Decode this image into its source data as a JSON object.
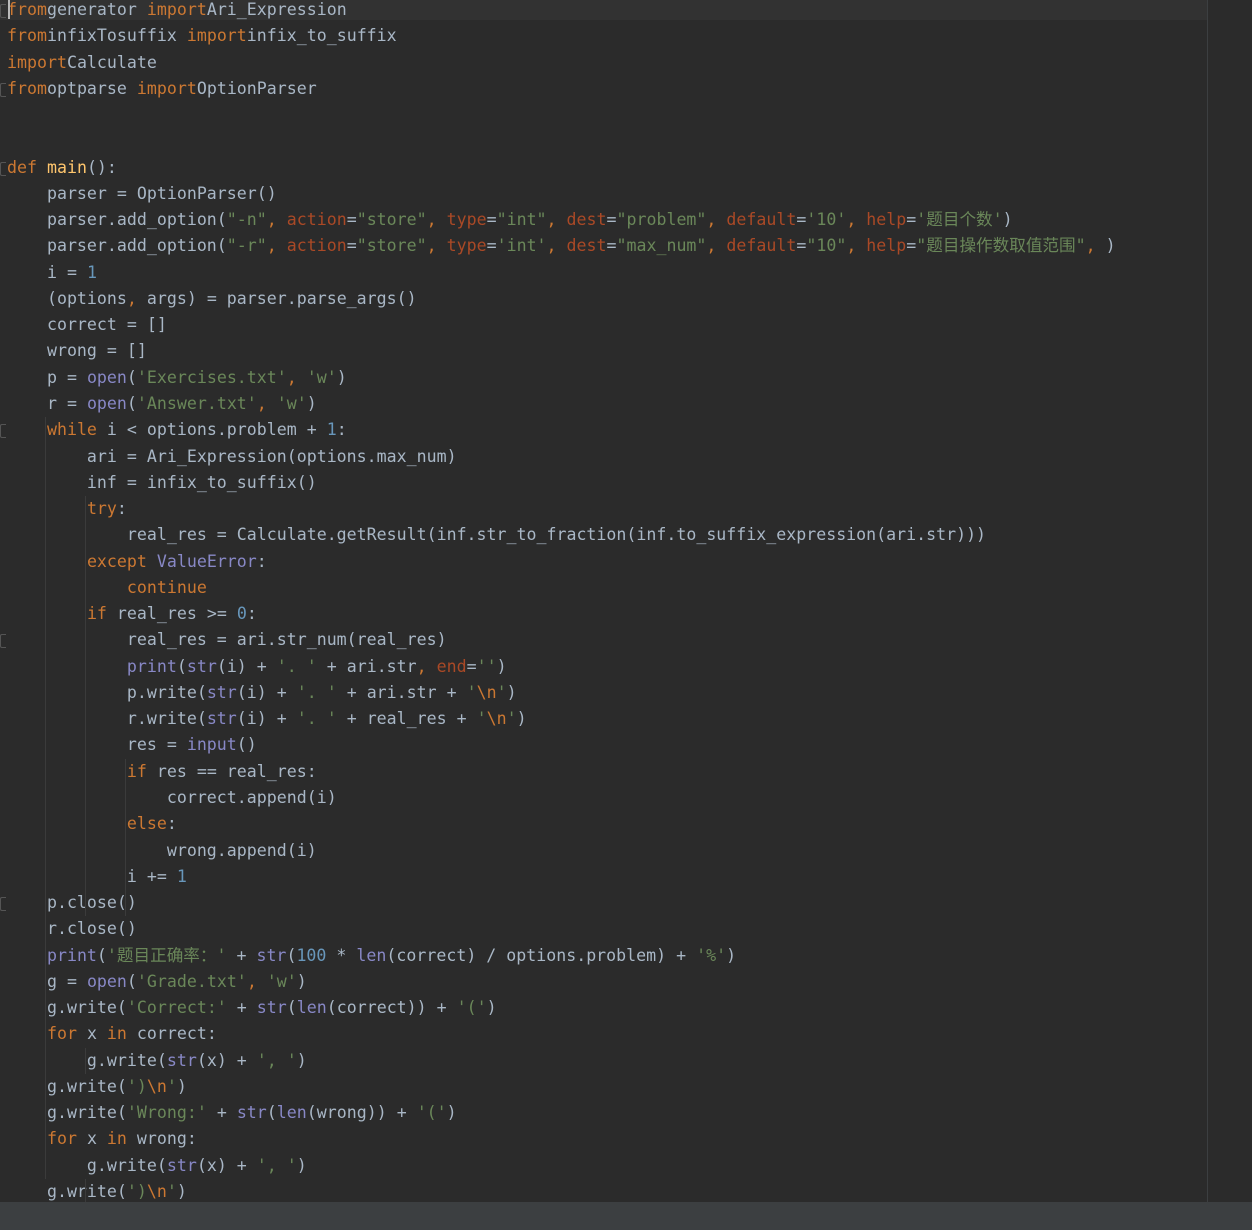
{
  "editor": {
    "language": "python",
    "lines": [
      [
        [
          "kw",
          "from"
        ],
        [
          "",
          "generator "
        ],
        [
          "kw",
          "import"
        ],
        [
          "",
          "Ari_Expression"
        ]
      ],
      [
        [
          "kw",
          "from"
        ],
        [
          "",
          "infixTosuffix "
        ],
        [
          "kw",
          "import"
        ],
        [
          "",
          "infix_to_suffix"
        ]
      ],
      [
        [
          "kw",
          "import"
        ],
        [
          "",
          "Calculate"
        ]
      ],
      [
        [
          "kw",
          "from"
        ],
        [
          "",
          "optparse "
        ],
        [
          "kw",
          "import"
        ],
        [
          "",
          "OptionParser"
        ]
      ],
      [],
      [],
      [
        [
          "kw",
          "def"
        ],
        [
          "",
          "main():"
        ]
      ],
      [
        [
          "",
          "    parser = OptionParser()"
        ]
      ],
      [
        [
          "",
          "    parser.add_option("
        ],
        [
          "str",
          "\"-n\""
        ],
        [
          "kw",
          ", "
        ],
        [
          "kwarg",
          "action"
        ],
        [
          "",
          "="
        ],
        [
          "str",
          "\"store\""
        ],
        [
          "kw",
          ", "
        ],
        [
          "kwarg",
          "type"
        ],
        [
          "",
          "="
        ],
        [
          "str",
          "\"int\""
        ],
        [
          "kw",
          ", "
        ],
        [
          "kwarg",
          "dest"
        ],
        [
          "",
          "="
        ],
        [
          "str",
          "\"problem\""
        ],
        [
          "kw",
          ", "
        ],
        [
          "kwarg",
          "default"
        ],
        [
          "",
          "="
        ],
        [
          "str",
          "'10'"
        ],
        [
          "kw",
          ", "
        ],
        [
          "kwarg",
          "help"
        ],
        [
          "",
          "="
        ],
        [
          "str",
          "'题目个数'"
        ],
        [
          "",
          ")"
        ]
      ],
      [
        [
          "",
          "    parser.add_option("
        ],
        [
          "str",
          "\"-r\""
        ],
        [
          "kw",
          ", "
        ],
        [
          "kwarg",
          "action"
        ],
        [
          "",
          "="
        ],
        [
          "str",
          "\"store\""
        ],
        [
          "kw",
          ", "
        ],
        [
          "kwarg",
          "type"
        ],
        [
          "",
          "="
        ],
        [
          "str",
          "'int'"
        ],
        [
          "kw",
          ", "
        ],
        [
          "kwarg",
          "dest"
        ],
        [
          "",
          "="
        ],
        [
          "str",
          "\"max_num\""
        ],
        [
          "kw",
          ", "
        ],
        [
          "kwarg",
          "default"
        ],
        [
          "",
          "="
        ],
        [
          "str",
          "\"10\""
        ],
        [
          "kw",
          ", "
        ],
        [
          "kwarg",
          "help"
        ],
        [
          "",
          "="
        ],
        [
          "str",
          "\"题目操作数取值范围\""
        ],
        [
          "kw",
          ", "
        ],
        [
          "",
          ")"
        ]
      ],
      [
        [
          "",
          "    i = "
        ],
        [
          "num",
          "1"
        ]
      ],
      [
        [
          "",
          "    (options"
        ],
        [
          "kw",
          ", "
        ],
        [
          "",
          "args) = parser.parse_args()"
        ]
      ],
      [
        [
          "",
          "    correct = []"
        ]
      ],
      [
        [
          "",
          "    wrong = []"
        ]
      ],
      [
        [
          "",
          "    p = "
        ],
        [
          "bi",
          "open"
        ],
        [
          "",
          "("
        ],
        [
          "str",
          "'Exercises.txt'"
        ],
        [
          "kw",
          ", "
        ],
        [
          "str",
          "'w'"
        ],
        [
          "",
          ")"
        ]
      ],
      [
        [
          "",
          "    r = "
        ],
        [
          "bi",
          "open"
        ],
        [
          "",
          "("
        ],
        [
          "str",
          "'Answer.txt'"
        ],
        [
          "kw",
          ", "
        ],
        [
          "str",
          "'w'"
        ],
        [
          "",
          ")"
        ]
      ],
      [
        [
          "",
          "    "
        ],
        [
          "kw",
          "while "
        ],
        [
          "",
          "i < options.problem + "
        ],
        [
          "num",
          "1"
        ],
        [
          "",
          ":"
        ]
      ],
      [
        [
          "",
          "        ari = Ari_Expression(options.max_num)"
        ]
      ],
      [
        [
          "",
          "        inf = infix_to_suffix()"
        ]
      ],
      [
        [
          "",
          "        "
        ],
        [
          "kw",
          "try"
        ],
        [
          "",
          ":"
        ]
      ],
      [
        [
          "",
          "            real_res = Calculate.getResult(inf.str_to_fraction(inf.to_suffix_expression(ari.str)))"
        ]
      ],
      [
        [
          "",
          "        "
        ],
        [
          "kw",
          "except "
        ],
        [
          "bi",
          "ValueError"
        ],
        [
          "",
          ":"
        ]
      ],
      [
        [
          "",
          "            "
        ],
        [
          "kw",
          "continue"
        ]
      ],
      [
        [
          "",
          "        "
        ],
        [
          "kw",
          "if "
        ],
        [
          "",
          "real_res >= "
        ],
        [
          "num",
          "0"
        ],
        [
          "",
          ":"
        ]
      ],
      [
        [
          "",
          "            real_res = ari.str_num(real_res)"
        ]
      ],
      [
        [
          "",
          "            "
        ],
        [
          "bi",
          "print"
        ],
        [
          "",
          "("
        ],
        [
          "bi",
          "str"
        ],
        [
          "",
          "(i) + "
        ],
        [
          "str",
          "'. '"
        ],
        [
          "",
          " + ari.str"
        ],
        [
          "kw",
          ", "
        ],
        [
          "kwarg",
          "end"
        ],
        [
          "",
          "="
        ],
        [
          "str",
          "''"
        ],
        [
          "",
          ")"
        ]
      ],
      [
        [
          "",
          "            p.write("
        ],
        [
          "bi",
          "str"
        ],
        [
          "",
          "(i) + "
        ],
        [
          "str",
          "'. '"
        ],
        [
          "",
          " + ari.str + "
        ],
        [
          "str",
          "'"
        ],
        [
          "esc",
          "\\n"
        ],
        [
          "str",
          "'"
        ],
        [
          "",
          ")"
        ]
      ],
      [
        [
          "",
          "            r.write("
        ],
        [
          "bi",
          "str"
        ],
        [
          "",
          "(i) + "
        ],
        [
          "str",
          "'. '"
        ],
        [
          "",
          " + real_res + "
        ],
        [
          "str",
          "'"
        ],
        [
          "esc",
          "\\n"
        ],
        [
          "str",
          "'"
        ],
        [
          "",
          ")"
        ]
      ],
      [
        [
          "",
          "            res = "
        ],
        [
          "bi",
          "input"
        ],
        [
          "",
          "()"
        ]
      ],
      [
        [
          "",
          "            "
        ],
        [
          "kw",
          "if "
        ],
        [
          "",
          "res == real_res:"
        ]
      ],
      [
        [
          "",
          "                correct.append(i)"
        ]
      ],
      [
        [
          "",
          "            "
        ],
        [
          "kw",
          "else"
        ],
        [
          "",
          ":"
        ]
      ],
      [
        [
          "",
          "                wrong.append(i)"
        ]
      ],
      [
        [
          "",
          "            i += "
        ],
        [
          "num",
          "1"
        ]
      ],
      [
        [
          "",
          "    p.close()"
        ]
      ],
      [
        [
          "",
          "    r.close()"
        ]
      ],
      [
        [
          "",
          "    "
        ],
        [
          "bi",
          "print"
        ],
        [
          "",
          "("
        ],
        [
          "str",
          "'题目正确率：'"
        ],
        [
          "",
          " + "
        ],
        [
          "bi",
          "str"
        ],
        [
          "",
          "("
        ],
        [
          "num",
          "100"
        ],
        [
          "",
          " * "
        ],
        [
          "bi",
          "len"
        ],
        [
          "",
          "(correct) / options.problem) + "
        ],
        [
          "str",
          "'%'"
        ],
        [
          "",
          ")"
        ]
      ],
      [
        [
          "",
          "    g = "
        ],
        [
          "bi",
          "open"
        ],
        [
          "",
          "("
        ],
        [
          "str",
          "'Grade.txt'"
        ],
        [
          "kw",
          ", "
        ],
        [
          "str",
          "'w'"
        ],
        [
          "",
          ")"
        ]
      ],
      [
        [
          "",
          "    g.write("
        ],
        [
          "str",
          "'Correct:'"
        ],
        [
          "",
          " + "
        ],
        [
          "bi",
          "str"
        ],
        [
          "",
          "("
        ],
        [
          "bi",
          "len"
        ],
        [
          "",
          "(correct)) + "
        ],
        [
          "str",
          "'('"
        ],
        [
          "",
          ")"
        ]
      ],
      [
        [
          "",
          "    "
        ],
        [
          "kw",
          "for "
        ],
        [
          "",
          "x "
        ],
        [
          "kw",
          "in "
        ],
        [
          "",
          "correct:"
        ]
      ],
      [
        [
          "",
          "        g.write("
        ],
        [
          "bi",
          "str"
        ],
        [
          "",
          "(x) + "
        ],
        [
          "str",
          "', '"
        ],
        [
          "",
          ")"
        ]
      ],
      [
        [
          "",
          "    g.write("
        ],
        [
          "str",
          "')"
        ],
        [
          "esc",
          "\\n"
        ],
        [
          "str",
          "'"
        ],
        [
          "",
          ")"
        ]
      ],
      [
        [
          "",
          "    g.write("
        ],
        [
          "str",
          "'Wrong:'"
        ],
        [
          "",
          " + "
        ],
        [
          "bi",
          "str"
        ],
        [
          "",
          "("
        ],
        [
          "bi",
          "len"
        ],
        [
          "",
          "(wrong)) + "
        ],
        [
          "str",
          "'('"
        ],
        [
          "",
          ")"
        ]
      ],
      [
        [
          "",
          "    "
        ],
        [
          "kw",
          "for "
        ],
        [
          "",
          "x "
        ],
        [
          "kw",
          "in "
        ],
        [
          "",
          "wrong:"
        ]
      ],
      [
        [
          "",
          "        g.write("
        ],
        [
          "bi",
          "str"
        ],
        [
          "",
          "(x) + "
        ],
        [
          "str",
          "', '"
        ],
        [
          "",
          ")"
        ]
      ],
      [
        [
          "",
          "    g.write("
        ],
        [
          "str",
          "')"
        ],
        [
          "esc",
          "\\n"
        ],
        [
          "str",
          "'"
        ],
        [
          "",
          ")"
        ]
      ]
    ]
  },
  "colors": {
    "background": "#2b2b2b",
    "text": "#a9b7c6",
    "keyword": "#cc7832",
    "string": "#6a8759",
    "number": "#6897bb",
    "builtin": "#8888c6",
    "kwarg": "#aa4926"
  }
}
